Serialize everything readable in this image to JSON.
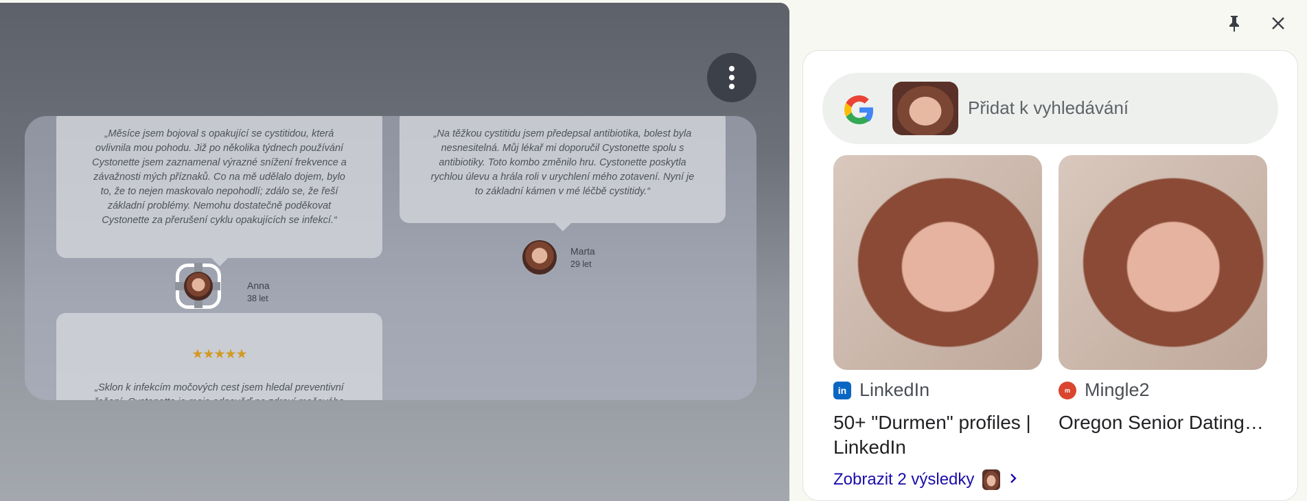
{
  "page": {
    "testimonials": [
      {
        "text": "„Měsíce jsem bojoval s opakující se cystitidou, která ovlivnila mou pohodu. Již po několika týdnech používání Cystonette jsem zaznamenal výrazné snížení frekvence a závažnosti mých příznaků. Co na mě udělalo dojem, bylo to, že to nejen maskovalo nepohodlí; zdálo se, že řeší základní problémy. Nemohu dostatečně poděkovat Cystonette za přerušení cyklu opakujících se infekcí.“",
        "name": "Anna",
        "age": "38 let"
      },
      {
        "text": "„Na těžkou cystitidu jsem předepsal antibiotika, bolest byla nesnesitelná. Můj lékař mi doporučil Cystonette spolu s antibiotiky. Toto kombo změnilo hru. Cystonette poskytla rychlou úlevu a hrála roli v urychlení mého zotavení. Nyní je to základní kámen v mé léčbě cystitidy.“",
        "name": "Marta",
        "age": "29 let"
      },
      {
        "stars": "★★★★★",
        "text": "„Sklon k infekcím močových cest jsem hledal preventivní řešení. Cystonette je moje odpověď na zdraví močového"
      }
    ]
  },
  "lens": {
    "search_placeholder": "Přidat k vyhledávání",
    "results": [
      {
        "source": "LinkedIn",
        "title": "50+ \"Durmen\" profiles | LinkedIn",
        "icon": "linkedin-icon",
        "color": "#0a66c2"
      },
      {
        "source": "Mingle2",
        "title": "Oregon Senior Dating Site, Senior Personals,...",
        "icon": "mingle2-icon",
        "color": "#d9452f"
      }
    ],
    "show_more": "Zobrazit 2 výsledky"
  }
}
